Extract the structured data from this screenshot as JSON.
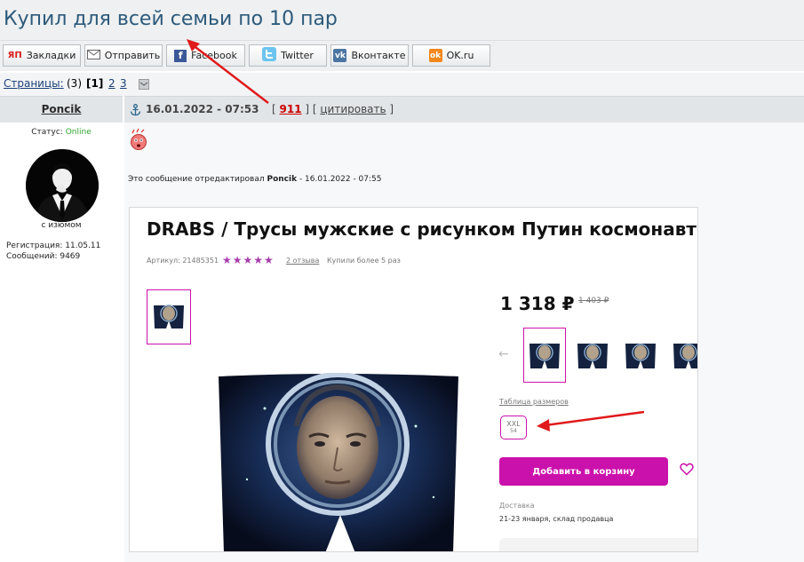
{
  "topic": {
    "title": "Купил для всей семьи по 10 пар"
  },
  "share": {
    "bookmarks": "Закладки",
    "send": "Отправить",
    "facebook": "Facebook",
    "twitter": "Twitter",
    "vkontakte": "Вконтакте",
    "okru": "OK.ru",
    "bookmarks_icon_text": "ЯП",
    "okru_icon_text": "ok",
    "vk_icon_text": "vk"
  },
  "pagination": {
    "label": "Страницы:",
    "count": "(3)",
    "current": "[1]",
    "page2": "2",
    "page3": "3"
  },
  "post": {
    "author": "Poncik",
    "datetime": "16.01.2022 - 07:53",
    "post_number": "911",
    "quote": "цитировать",
    "edited_prefix": "Это сообщение отредактировал",
    "edited_author": "Poncik",
    "edited_time": "- 16.01.2022 - 07:55"
  },
  "user": {
    "status_label": "Статус:",
    "status_value": "Online",
    "avatar_caption": "с изюмом",
    "reg_label": "Регистрация:",
    "reg_value": "11.05.11",
    "posts_label": "Сообщений:",
    "posts_value": "9469"
  },
  "product": {
    "title": "DRABS / Трусы мужские с рисунком Путин космонавт",
    "sku_label": "Артикул:",
    "sku": "21485351",
    "rating_stars": 5,
    "reviews": "2 отзыва",
    "bought": "Купили более 5 раз",
    "price": "1 318 ₽",
    "old_price": "1 403 ₽",
    "size_table_label": "Таблица размеров",
    "size_label": "XXL",
    "size_sub": "54",
    "add_to_cart": "Добавить в корзину",
    "delivery_label": "Доставка",
    "delivery_value": "21-23 января, склад продавца"
  },
  "colors": {
    "topic_title": "#2d5a7b",
    "accent_purple": "#cb11ab",
    "status_online": "#2ea52e",
    "post_number": "#cc0000",
    "annotation_arrow": "#e0191b"
  },
  "icons": [
    "bookmark-icon",
    "mail-icon",
    "facebook-icon",
    "twitter-icon",
    "vk-icon",
    "ok-icon",
    "anchor-icon",
    "email-topic-icon",
    "smiley-icon",
    "heart-icon",
    "arrow-left-icon"
  ]
}
